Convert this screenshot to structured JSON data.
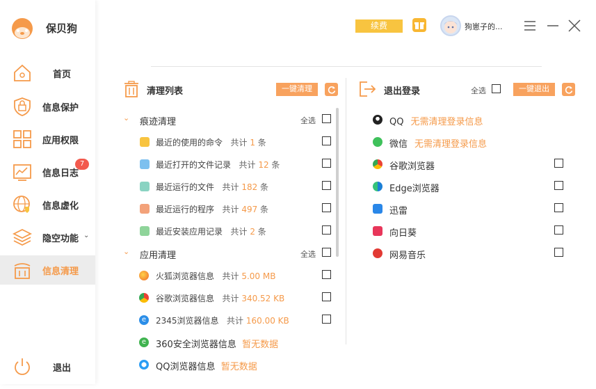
{
  "brand": {
    "name": "保贝狗"
  },
  "sidebar": {
    "items": [
      {
        "label": "首页"
      },
      {
        "label": "信息保护"
      },
      {
        "label": "应用权限"
      },
      {
        "label": "信息日志",
        "badge": "7"
      },
      {
        "label": "信息虚化"
      },
      {
        "label": "隐空功能"
      },
      {
        "label": "信息清理"
      }
    ],
    "logout_label": "退出"
  },
  "topbar": {
    "renew_label": "续费",
    "username": "狗崽子的...",
    "icons": [
      "gift-icon",
      "menu-icon",
      "minimize-icon",
      "close-icon"
    ]
  },
  "clean": {
    "title": "清理列表",
    "one_click_label": "一键清理",
    "groups": [
      {
        "title": "痕迹清理",
        "select_all": "全选",
        "items": [
          {
            "name": "最近的使用的命令",
            "prefix": "共计",
            "count": "1",
            "unit": "条"
          },
          {
            "name": "最近打开的文件记录",
            "prefix": "共计",
            "count": "12",
            "unit": "条"
          },
          {
            "name": "最近运行的文件",
            "prefix": "共计",
            "count": "182",
            "unit": "条"
          },
          {
            "name": "最近运行的程序",
            "prefix": "共计",
            "count": "497",
            "unit": "条"
          },
          {
            "name": "最近安装应用记录",
            "prefix": "共计",
            "count": "2",
            "unit": "条"
          }
        ]
      },
      {
        "title": "应用清理",
        "select_all": "全选",
        "items": [
          {
            "name": "火狐浏览器信息",
            "prefix": "共计",
            "count": "5.00 MB"
          },
          {
            "name": "谷歌浏览器信息",
            "prefix": "共计",
            "count": "340.52 KB"
          },
          {
            "name": "2345浏览器信息",
            "prefix": "共计",
            "count": "160.00 KB"
          },
          {
            "name": "360安全浏览器信息",
            "status": "暂无数据"
          },
          {
            "name": "QQ浏览器信息",
            "status": "暂无数据"
          }
        ]
      }
    ]
  },
  "logout_panel": {
    "title": "退出登录",
    "select_all": "全选",
    "one_click_label": "一键退出",
    "apps": [
      {
        "name": "QQ",
        "status": "无需清理登录信息"
      },
      {
        "name": "微信",
        "status": "无需清理登录信息"
      },
      {
        "name": "谷歌浏览器"
      },
      {
        "name": "Edge浏览器"
      },
      {
        "name": "迅雷"
      },
      {
        "name": "向日葵"
      },
      {
        "name": "网易音乐"
      }
    ]
  },
  "colors": {
    "accent": "#f59a4a",
    "button": "#f8a25e",
    "renew": "#f8c440",
    "badge": "#f25a4e"
  }
}
